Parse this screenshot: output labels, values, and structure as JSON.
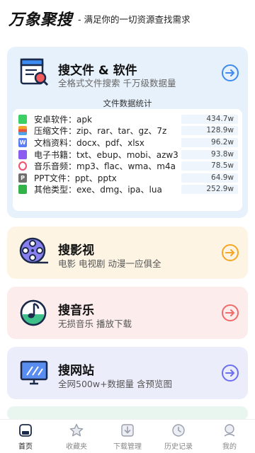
{
  "header": {
    "logo": "万象聚搜",
    "slogan": "- 满足你的一切资源查找需求"
  },
  "main_card": {
    "title": "搜文件 & 软件",
    "subtitle": "全格式文件搜索 千万级数据量",
    "stats_title": "文件数据统计",
    "rows": [
      {
        "label": "安卓软件：apk",
        "value": "434.7w",
        "icon": "android-app-icon",
        "color": "#3ccf63"
      },
      {
        "label": "压缩文件：zip、rar、tar、gz、7z",
        "value": "128.9w",
        "icon": "archive-icon",
        "color": "#f3a32b"
      },
      {
        "label": "文档资料：docx、pdf、xlsx",
        "value": "96.2w",
        "icon": "word-doc-icon",
        "color": "#5b7df5"
      },
      {
        "label": "电子书籍：txt、ebup、mobi、azw3",
        "value": "93.8w",
        "icon": "ebook-icon",
        "color": "#8c5cf0"
      },
      {
        "label": "音乐音频：mp3、flac、wma、m4a",
        "value": "78.5w",
        "icon": "music-file-icon",
        "color": "#f0506e"
      },
      {
        "label": "PPT文件：ppt、pptx",
        "value": "64.9w",
        "icon": "ppt-file-icon",
        "color": "#6f6f6f"
      },
      {
        "label": "其他类型：exe、dmg、ipa、lua",
        "value": "252.9w",
        "icon": "other-file-icon",
        "color": "#33b24a"
      }
    ]
  },
  "video_card": {
    "title": "搜影视",
    "subtitle": "电影 电视剧 动漫一应俱全",
    "accent": "#f5a623"
  },
  "music_card": {
    "title": "搜音乐",
    "subtitle": "无损音乐 播放下载",
    "accent": "#f06a6a"
  },
  "web_card": {
    "title": "搜网站",
    "subtitle": "全网500w+数据量 含预览图",
    "accent": "#6a6ef0"
  },
  "colors": {
    "main_accent": "#3d8af0",
    "card_main_bg": "#e6f1fb"
  },
  "tabbar": {
    "items": [
      {
        "label": "首页",
        "icon": "home-icon",
        "active": true
      },
      {
        "label": "收藏夹",
        "icon": "star-icon",
        "active": false
      },
      {
        "label": "下载管理",
        "icon": "download-icon",
        "active": false
      },
      {
        "label": "历史记录",
        "icon": "history-icon",
        "active": false
      },
      {
        "label": "我的",
        "icon": "profile-icon",
        "active": false
      }
    ]
  }
}
